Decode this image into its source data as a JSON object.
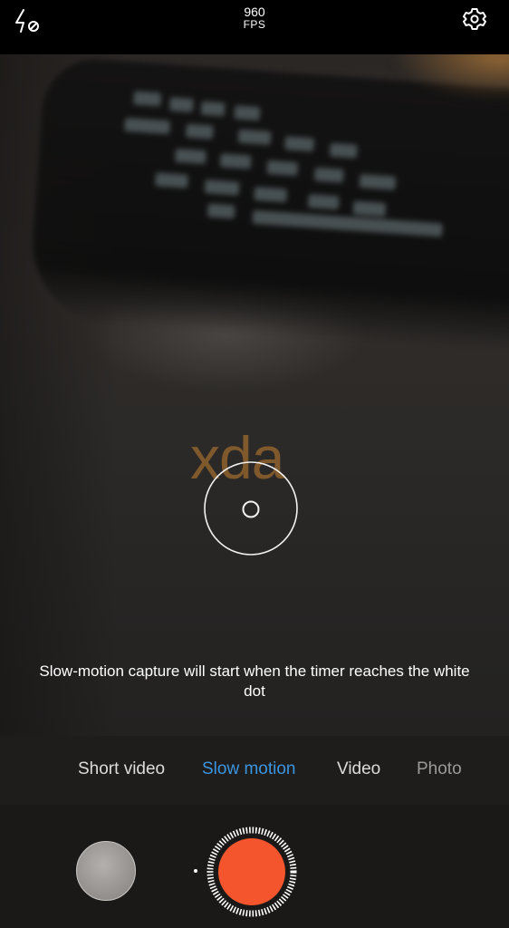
{
  "topbar": {
    "flash_icon": "flash-off-icon",
    "fps_value": "960",
    "fps_unit": "FPS",
    "settings_icon": "gear-icon"
  },
  "viewfinder": {
    "watermark": "xda",
    "hint": "Slow-motion capture will start when the timer reaches the white dot"
  },
  "modes": [
    {
      "label": "Short video"
    },
    {
      "label": "Slow motion",
      "active": true
    },
    {
      "label": "Video"
    },
    {
      "label": "Photo"
    }
  ],
  "colors": {
    "active_mode": "#3a95e0",
    "shutter": "#f4552d",
    "watermark": "#c48232"
  },
  "controls": {
    "gallery_icon": "gallery-thumbnail",
    "shutter_icon": "record-button"
  }
}
